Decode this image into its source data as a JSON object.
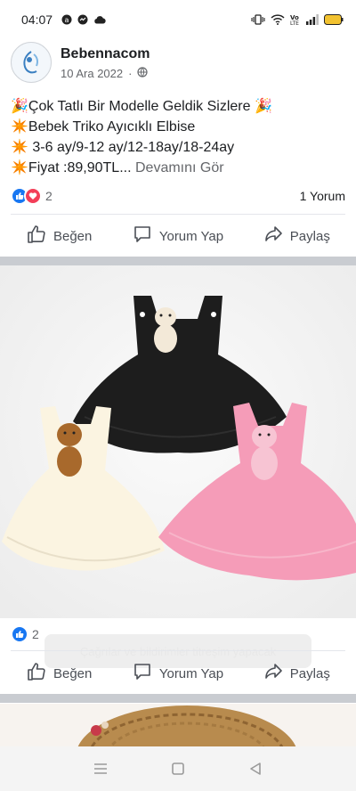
{
  "status_bar": {
    "time": "04:07"
  },
  "post": {
    "author": "Bebennacom",
    "date": "10 Ara 2022",
    "date_separator": "·",
    "text_lines": [
      "🎉Çok Tatlı Bir Modelle Geldik Sizlere 🎉",
      "✴️Bebek Triko Ayıcıklı Elbise",
      "✴️ 3-6 ay/9-12 ay/12-18ay/18-24ay"
    ],
    "price_line": "✴️Fiyat :89,90TL...",
    "see_more": "Devamını Gör",
    "reaction_count": "2",
    "comment_count": "1 Yorum"
  },
  "actions": {
    "like": "Beğen",
    "comment": "Yorum Yap",
    "share": "Paylaş"
  },
  "post2": {
    "reaction_count": "2"
  },
  "toast": {
    "text": "Çağrılar ve bildirimler titreşim yapacak"
  },
  "colors": {
    "facebook_blue": "#1877f2",
    "love_red": "#f33e58",
    "divider": "#e4e6eb",
    "band": "#c9ccd1"
  }
}
